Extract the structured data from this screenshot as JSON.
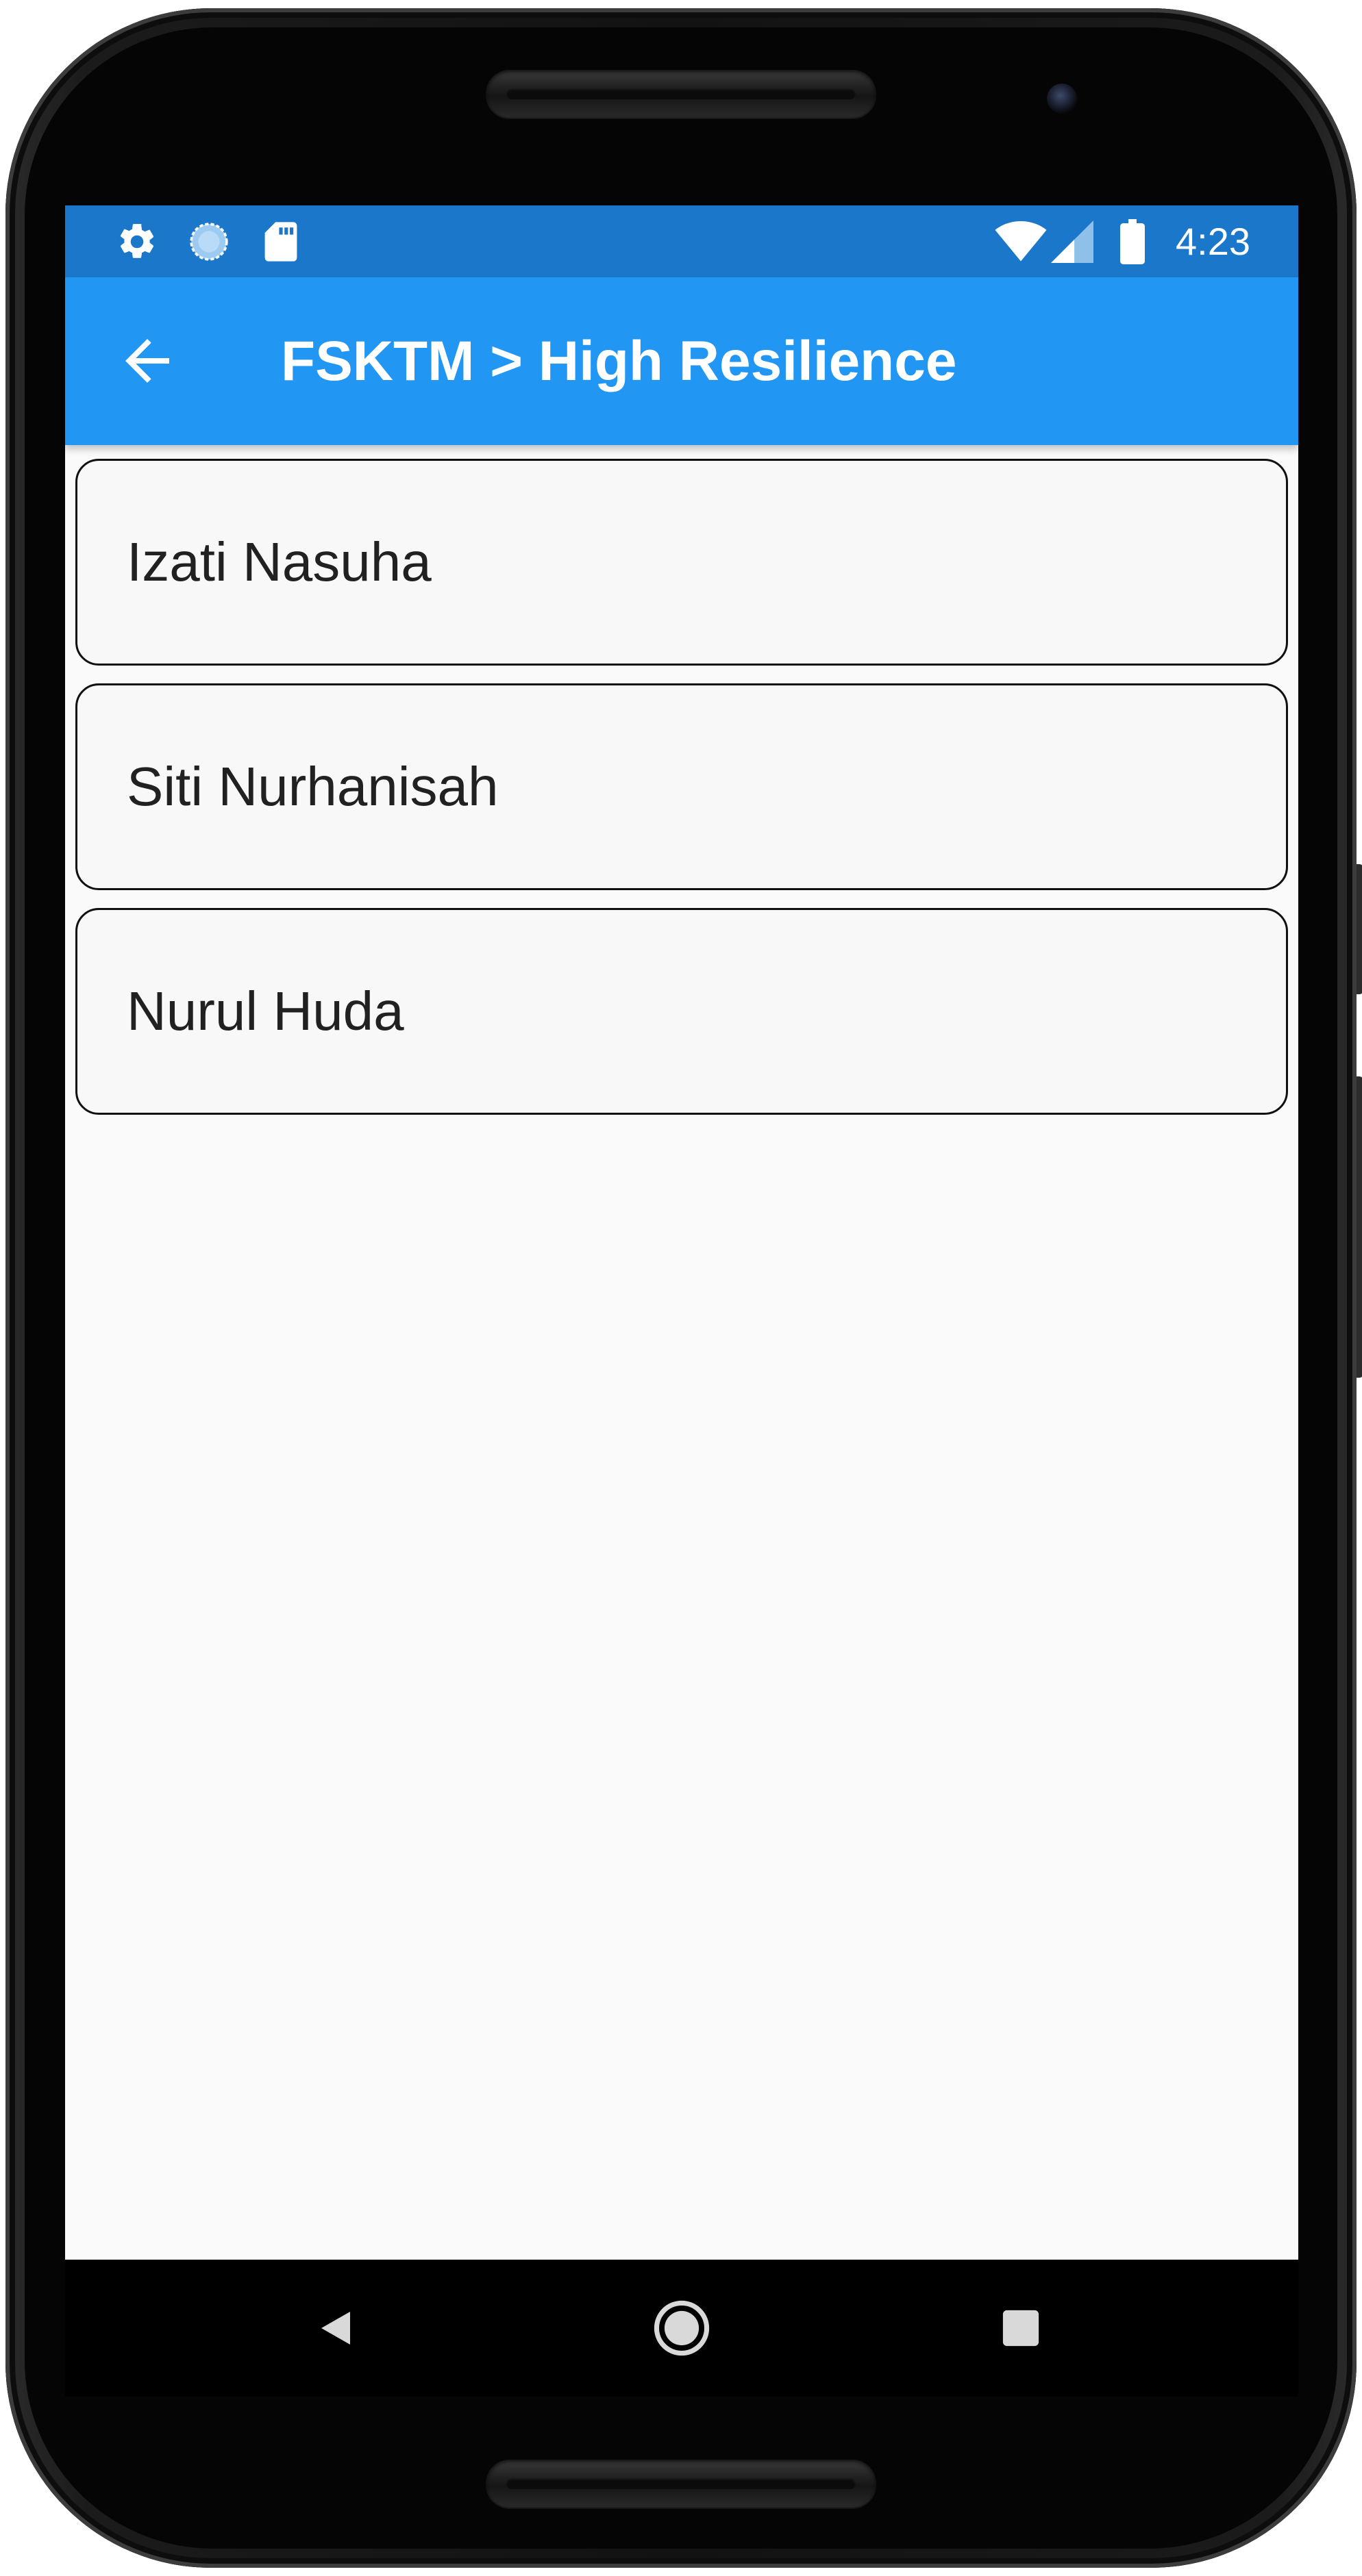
{
  "status_bar": {
    "time": "4:23",
    "left_icons": [
      "settings-icon",
      "sync-progress-icon",
      "sd-card-icon"
    ],
    "right_icons": [
      "wifi-icon",
      "cellular-signal-icon",
      "battery-icon"
    ],
    "background_color": "#1a77c9"
  },
  "app_bar": {
    "title": "FSKTM > High Resilience",
    "back_icon": "arrow-back-icon",
    "background_color": "#2196f3"
  },
  "list": {
    "items": [
      {
        "label": "Izati Nasuha"
      },
      {
        "label": "Siti Nurhanisah"
      },
      {
        "label": "Nurul Huda"
      }
    ]
  },
  "nav_bar": {
    "buttons": [
      "back-triangle-icon",
      "home-circle-icon",
      "recents-square-icon"
    ]
  }
}
